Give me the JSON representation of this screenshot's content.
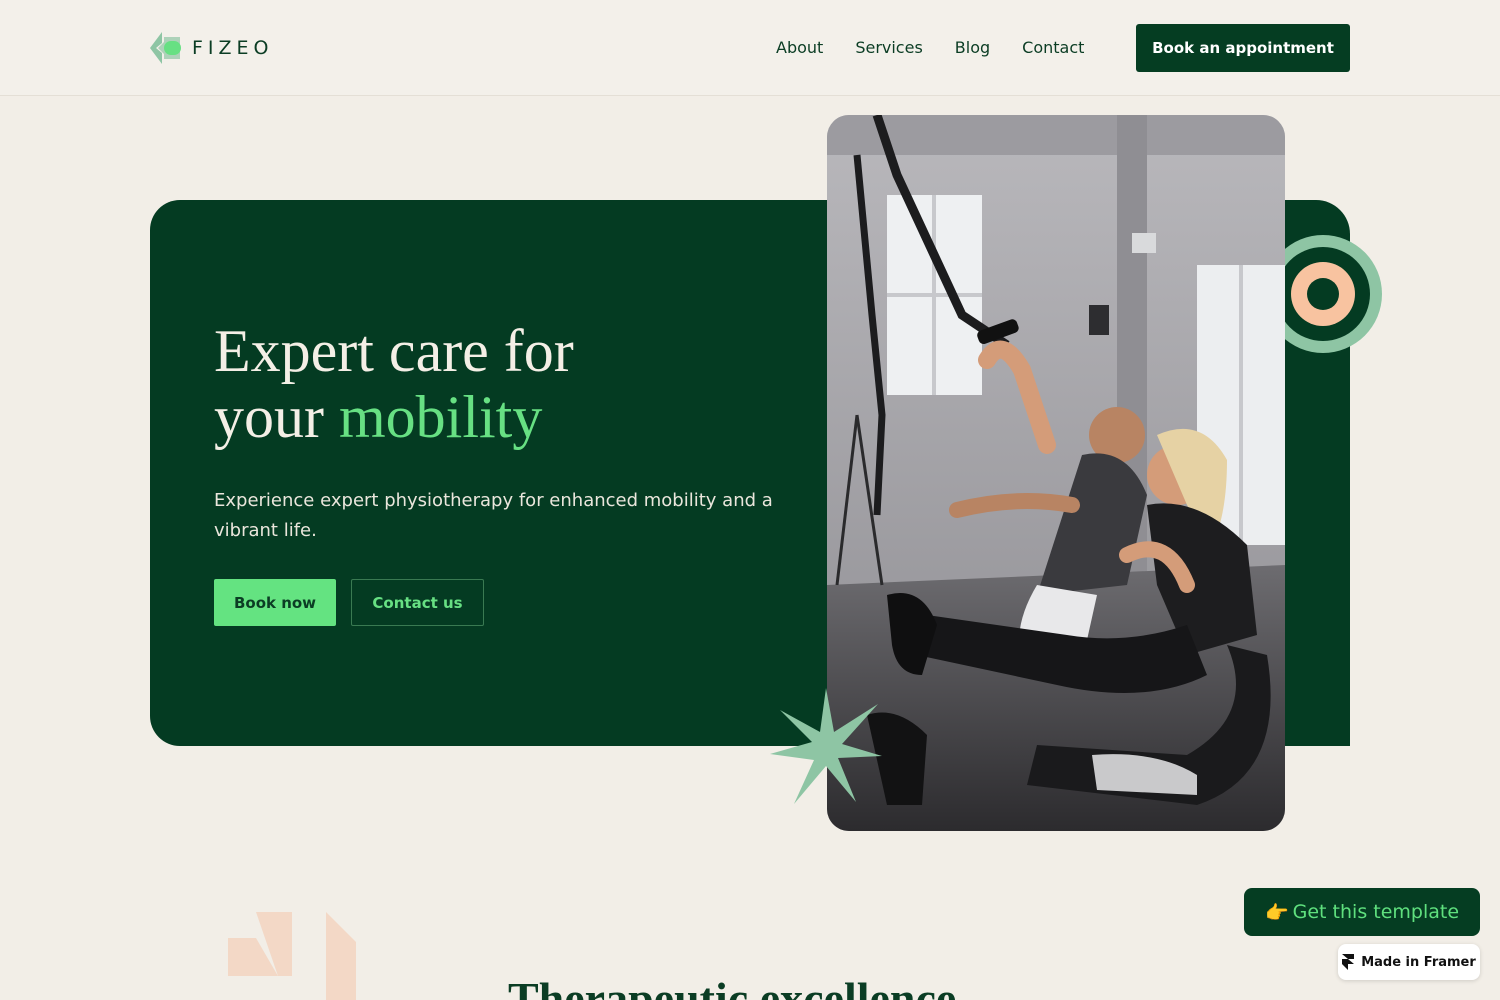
{
  "header": {
    "logo_text": "FIZEO",
    "nav": [
      "About",
      "Services",
      "Blog",
      "Contact"
    ],
    "cta_label": "Book an appointment"
  },
  "hero": {
    "title_line1": "Expert care for",
    "title_line2_plain": "your",
    "title_line2_accent": "mobility",
    "subtitle": "Experience expert physiotherapy for enhanced mobility and a vibrant life.",
    "primary_button": "Book now",
    "secondary_button": "Contact us",
    "photo_icon": "gym-training-photo"
  },
  "section": {
    "title": "Therapeutic excellence"
  },
  "framer": {
    "template_emoji": "👉",
    "template_label": "Get this template",
    "badge_label": "Made in Framer",
    "badge_icon": "framer-logo-icon"
  },
  "colors": {
    "background": "#f2eee7",
    "brand_dark": "#043b22",
    "accent_green": "#67e083",
    "peach": "#f8c3a0",
    "sage": "#8ec5a4"
  }
}
